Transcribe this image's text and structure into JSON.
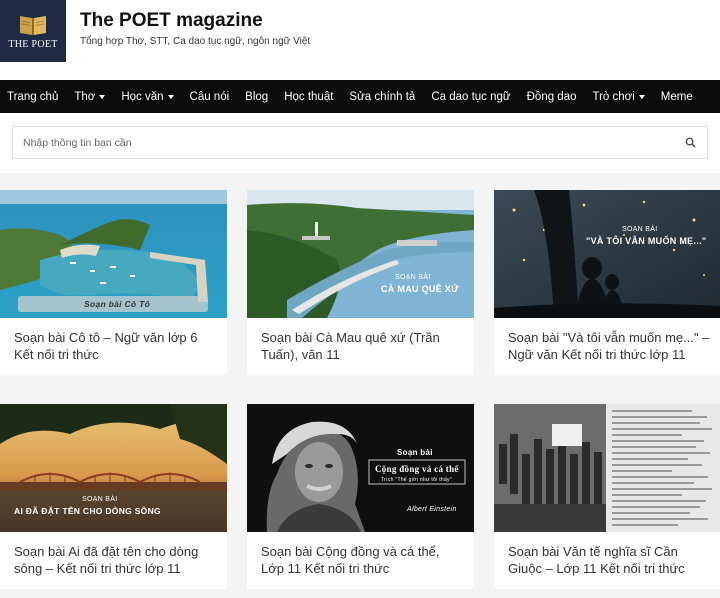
{
  "site": {
    "logo_text": "THE POET",
    "title": "The POET magazine",
    "tagline": "Tổng hợp Thơ, STT, Ca dao tục ngữ, ngôn ngữ Việt"
  },
  "nav": {
    "items": [
      {
        "label": "Trang chủ",
        "dropdown": false
      },
      {
        "label": "Thơ",
        "dropdown": true
      },
      {
        "label": "Học văn",
        "dropdown": true
      },
      {
        "label": "Câu nói",
        "dropdown": false
      },
      {
        "label": "Blog",
        "dropdown": false
      },
      {
        "label": "Học thuật",
        "dropdown": false
      },
      {
        "label": "Sửa chính tả",
        "dropdown": false
      },
      {
        "label": "Ca dao tục ngữ",
        "dropdown": false
      },
      {
        "label": "Đồng dao",
        "dropdown": false
      },
      {
        "label": "Trò chơi",
        "dropdown": true
      },
      {
        "label": "Meme",
        "dropdown": false
      }
    ]
  },
  "search": {
    "placeholder": "Nhập thông tin bạn cần",
    "value": ""
  },
  "posts": [
    {
      "title": "Soạn bài Cô tô – Ngữ văn lớp 6 Kết nối tri thức",
      "thumb_label": "Soạn bài Cô Tô"
    },
    {
      "title": "Soạn bài Cà Mau quê xứ (Trần Tuấn), văn 11",
      "thumb_kicker": "SOẠN BÀI",
      "thumb_label": "CÀ MAU QUÊ XỨ"
    },
    {
      "title": "Soạn bài \"Và tôi vẫn muốn mẹ...\" – Ngữ văn Kết nối tri thức lớp 11",
      "thumb_kicker": "SOẠN BÀI",
      "thumb_label": "\"VÀ TÔI VẪN MUỐN MẸ...\""
    },
    {
      "title": "Soạn bài Ai đã đặt tên cho dòng sông – Kết nối tri thức lớp 11",
      "thumb_kicker": "SOẠN BÀI",
      "thumb_label": "AI ĐÃ ĐẶT TÊN CHO DÒNG SÔNG"
    },
    {
      "title": "Soạn bài Cộng đồng và cá thể, Lớp 11 Kết nối tri thức",
      "thumb_kicker": "Soạn bài",
      "thumb_label": "Cộng đồng và cá thể",
      "thumb_sub": "Trích \"Thế giới như tôi thấy\"",
      "thumb_sign": "Albert Einstein"
    },
    {
      "title": "Soạn bài Văn tế nghĩa sĩ Cần Giuộc – Lớp 11 Kết nối tri thức",
      "thumb_label": ""
    }
  ],
  "colors": {
    "nav_bg": "#0b0b0b",
    "logo_bg": "#1f2a44",
    "page_bg": "#f4f4f4"
  }
}
